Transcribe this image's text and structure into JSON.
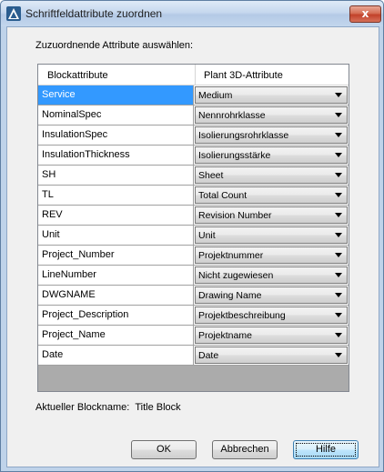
{
  "window": {
    "title": "Schriftfeldattribute zuordnen",
    "close_glyph": "x"
  },
  "instruction": "Zuzuordnende Attribute auswählen:",
  "grid": {
    "headers": [
      "Blockattribute",
      "Plant 3D-Attribute"
    ],
    "rows": [
      {
        "attribute": "Service",
        "mapping": "Medium"
      },
      {
        "attribute": "NominalSpec",
        "mapping": "Nennrohrklasse"
      },
      {
        "attribute": "InsulationSpec",
        "mapping": "Isolierungsrohrklasse"
      },
      {
        "attribute": "InsulationThickness",
        "mapping": "Isolierungsstärke"
      },
      {
        "attribute": "SH",
        "mapping": "Sheet"
      },
      {
        "attribute": "TL",
        "mapping": "Total Count"
      },
      {
        "attribute": "REV",
        "mapping": "Revision Number"
      },
      {
        "attribute": "Unit",
        "mapping": "Unit"
      },
      {
        "attribute": "Project_Number",
        "mapping": "Projektnummer"
      },
      {
        "attribute": "LineNumber",
        "mapping": "Nicht zugewiesen"
      },
      {
        "attribute": "DWGNAME",
        "mapping": "Drawing Name"
      },
      {
        "attribute": "Project_Description",
        "mapping": "Projektbeschreibung"
      },
      {
        "attribute": "Project_Name",
        "mapping": "Projektname"
      },
      {
        "attribute": "Date",
        "mapping": "Date"
      }
    ],
    "selected_row": 0
  },
  "block": {
    "label": "Aktueller Blockname:",
    "value": "Title Block"
  },
  "buttons": {
    "ok": "OK",
    "cancel": "Abbrechen",
    "help": "Hilfe"
  },
  "colors": {
    "selection": "#3399ff",
    "dialog_bg": "#f0f0f0",
    "frame": "#bfd3ea",
    "close": "#c2412a"
  }
}
